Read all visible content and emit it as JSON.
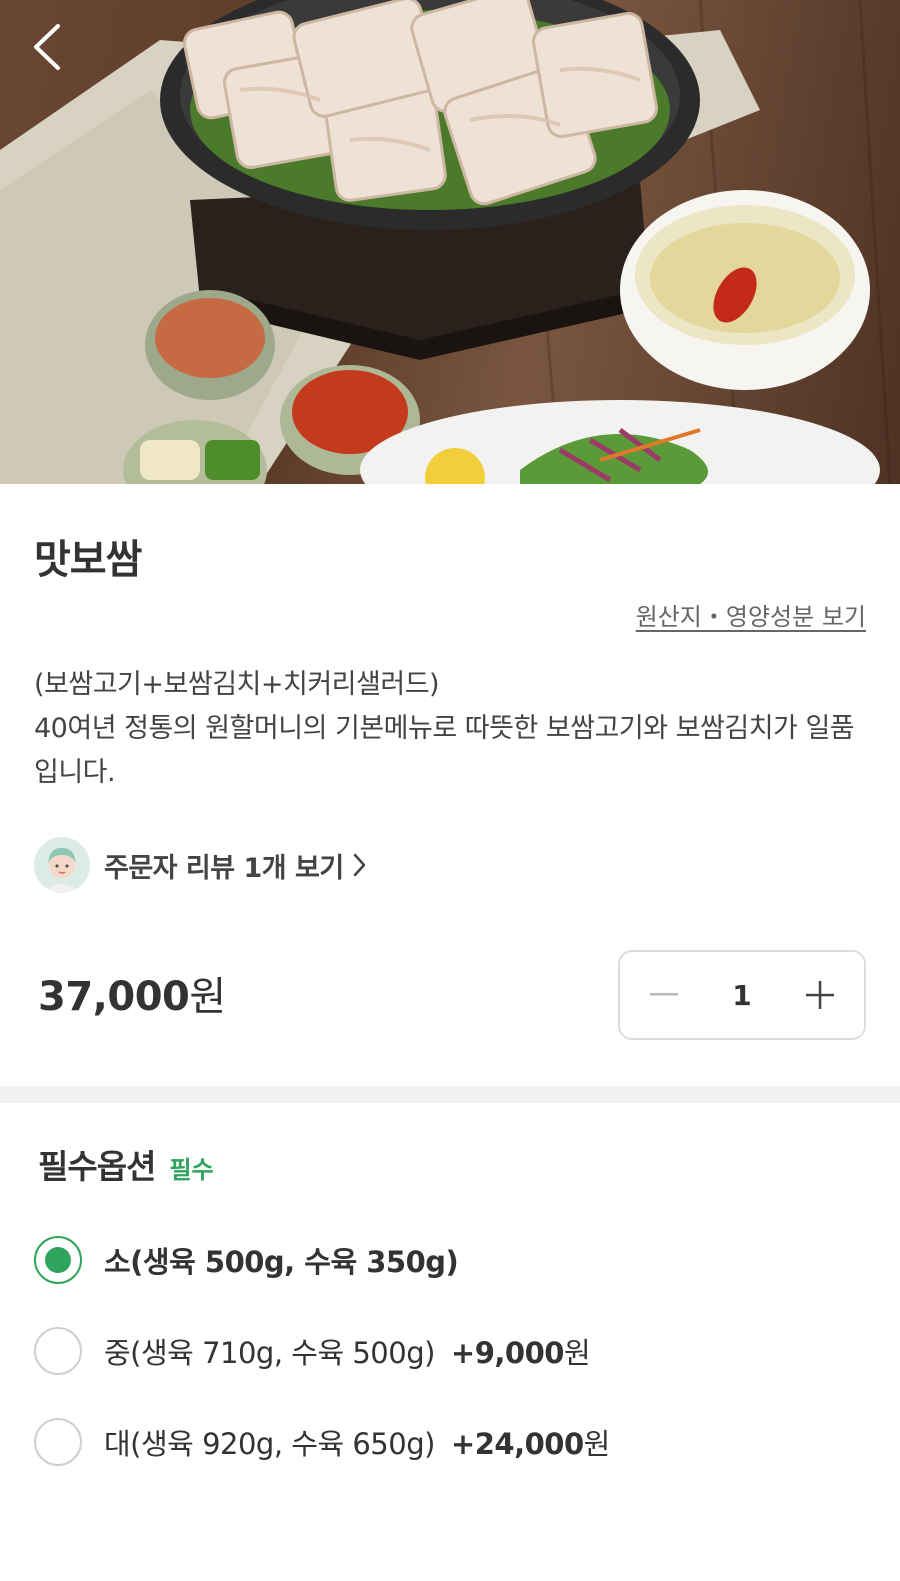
{
  "menu": {
    "name": "맛보쌈",
    "origin_link": "원산지・영양성분 보기",
    "description_line1": "(보쌈고기+보쌈김치+치커리샐러드)",
    "description_line2": "40여년 정통의 원할머니의 기본메뉴로 따뜻한 보쌈고기와 보쌈김치가 일품입니다."
  },
  "review": {
    "label": "주문자 리뷰 1개 보기"
  },
  "price": {
    "amount": "37,000",
    "unit": "원"
  },
  "quantity": {
    "value": "1"
  },
  "options": {
    "title": "필수옵션",
    "required_badge": "필수",
    "items": [
      {
        "label": "소(생육 500g, 수육 350g)",
        "extra_amount": "",
        "extra_unit": "",
        "selected": true
      },
      {
        "label": "중(생육 710g, 수육 500g)",
        "extra_amount": "+9,000",
        "extra_unit": "원",
        "selected": false
      },
      {
        "label": "대(생육 920g, 수육 650g)",
        "extra_amount": "+24,000",
        "extra_unit": "원",
        "selected": false
      }
    ]
  },
  "colors": {
    "accent": "#2ea45d",
    "divider": "#f0f1f3"
  },
  "icons": {
    "back": "chevron-left-icon",
    "review_arrow": "chevron-right-icon",
    "minus": "minus-icon",
    "plus": "plus-icon"
  }
}
